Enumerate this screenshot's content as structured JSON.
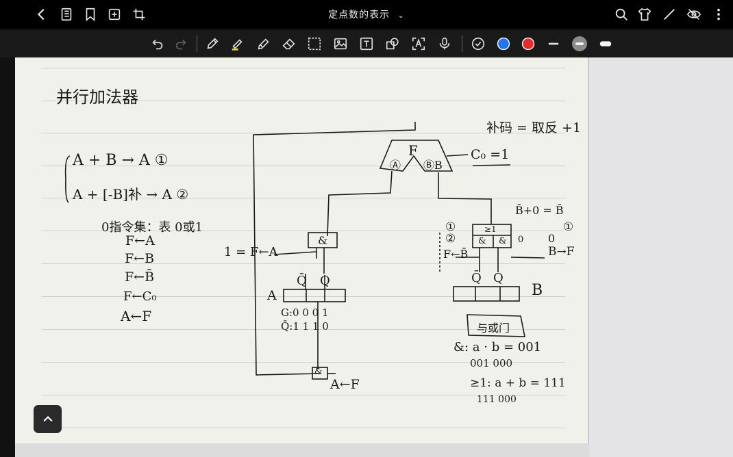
{
  "app": {
    "document_title": "定点数的表示",
    "title_chevron_icon": "chevron-down-icon"
  },
  "topbar": {
    "left_icons": [
      "back-icon",
      "notebook-icon",
      "bookmark-icon",
      "add-page-icon",
      "crop-icon"
    ],
    "right_icons": [
      "search-icon",
      "shirt-icon",
      "pen-icon",
      "eye-off-icon",
      "more-icon"
    ]
  },
  "toolbar": {
    "tools": [
      "undo-icon",
      "redo-icon",
      "pen-tool-icon",
      "highlighter-icon",
      "pencil-icon",
      "eraser-icon",
      "lasso-icon",
      "image-icon",
      "text-icon",
      "shape-icon",
      "ocr-icon",
      "mic-icon",
      "clock-icon"
    ],
    "colors": [
      "#2673f0",
      "#e52b2b"
    ],
    "stroke_widths": [
      "thin",
      "medium",
      "thick"
    ]
  },
  "notes": {
    "heading": "并行加法器",
    "complement_rule": "补码 = 取反 +1",
    "eq1": "A + B → A ①",
    "eq2": "A + [-B]补 → A ②",
    "instruction_set_label": "0指令集：表 0或1",
    "instructions": [
      "F←A",
      "F←B",
      "F←B̄",
      "F←C₀",
      "A←F"
    ],
    "c0": "C₀ =1",
    "b_not_plus": "B̄+0 = B̄",
    "i_f_a": "1 = F←A",
    "f_b": "F←B̄",
    "b_to_f": "B→F",
    "b_out_0": "0",
    "circle1": "①",
    "circle2": "②",
    "q_bar": "Q̄",
    "q": "Q",
    "a_label": "A",
    "b_label": "B",
    "g_bits": "G:0 0 0 1",
    "q_bits": "Q̄:1 1 1 0",
    "a_from_f": "A←F",
    "gate_and": "&",
    "gate_or": "≥1",
    "gate_box": "与或门",
    "and_eq": "&: a · b = 001",
    "and_vals": "001 000",
    "or_eq": "≥1: a + b = 111",
    "or_vals": "111 000",
    "adder_F": "F",
    "adder_A": "Ⓐ",
    "adder_B": "ⒷB"
  }
}
